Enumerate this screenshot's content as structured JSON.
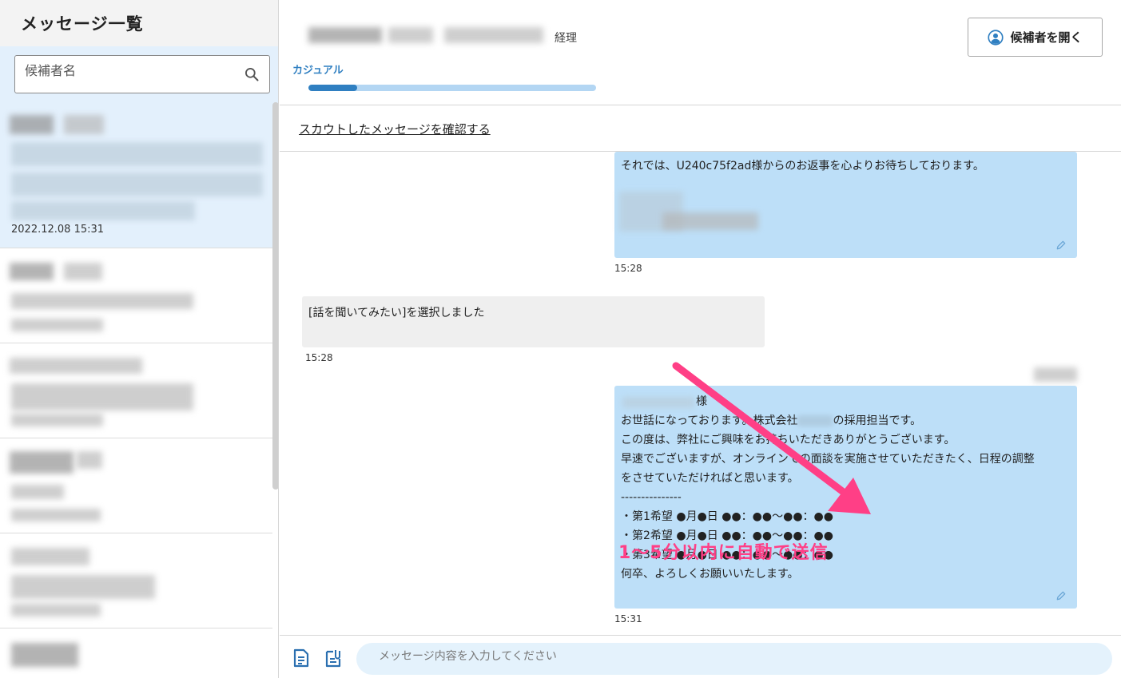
{
  "sidebar": {
    "title": "メッセージ一覧",
    "search_placeholder": "候補者名",
    "active_item_date": "2022.12.08 15:31"
  },
  "header": {
    "dept_label": "経理",
    "status_label": "カジュアル",
    "progress": 0.17,
    "open_candidate_label": "候補者を開く",
    "scout_link_label": "スカウトしたメッセージを確認する"
  },
  "messages": [
    {
      "type": "outgoing",
      "lines": [
        "それでは、U240c75f2ad様からのお返事を心よりお待ちしております。"
      ],
      "time": "15:28"
    },
    {
      "type": "incoming",
      "lines": [
        "[話を聞いてみたい]を選択しました"
      ],
      "time": "15:28"
    },
    {
      "type": "outgoing",
      "lines": [
        "様",
        "お世話になっております。株式会社",
        "の採用担当です。",
        "この度は、弊社にご興味をお持ちいただきありがとうございます。",
        "早速でございますが、オンラインでの面談を実施させていただきたく、日程の調整",
        "をさせていただければと思います。",
        "---------------",
        "・第1希望 ●月●日 ●●：●●〜●●：●●",
        "・第2希望 ●月●日 ●●：●●〜●●：●●",
        "・第3希望 ●月●日 ●●：●●〜●●：●●",
        "何卒、よろしくお願いいたします。"
      ],
      "time": "15:31"
    }
  ],
  "annotation": {
    "text": "1〜5分以内に自動で送信",
    "color": "#ff3f86"
  },
  "composer": {
    "placeholder": "メッセージ内容を入力してください"
  },
  "colors": {
    "accent": "#2f7fc1",
    "bubble_out": "#bddff8",
    "bubble_in": "#efefef",
    "sidebar_active": "#e3f0fc"
  }
}
